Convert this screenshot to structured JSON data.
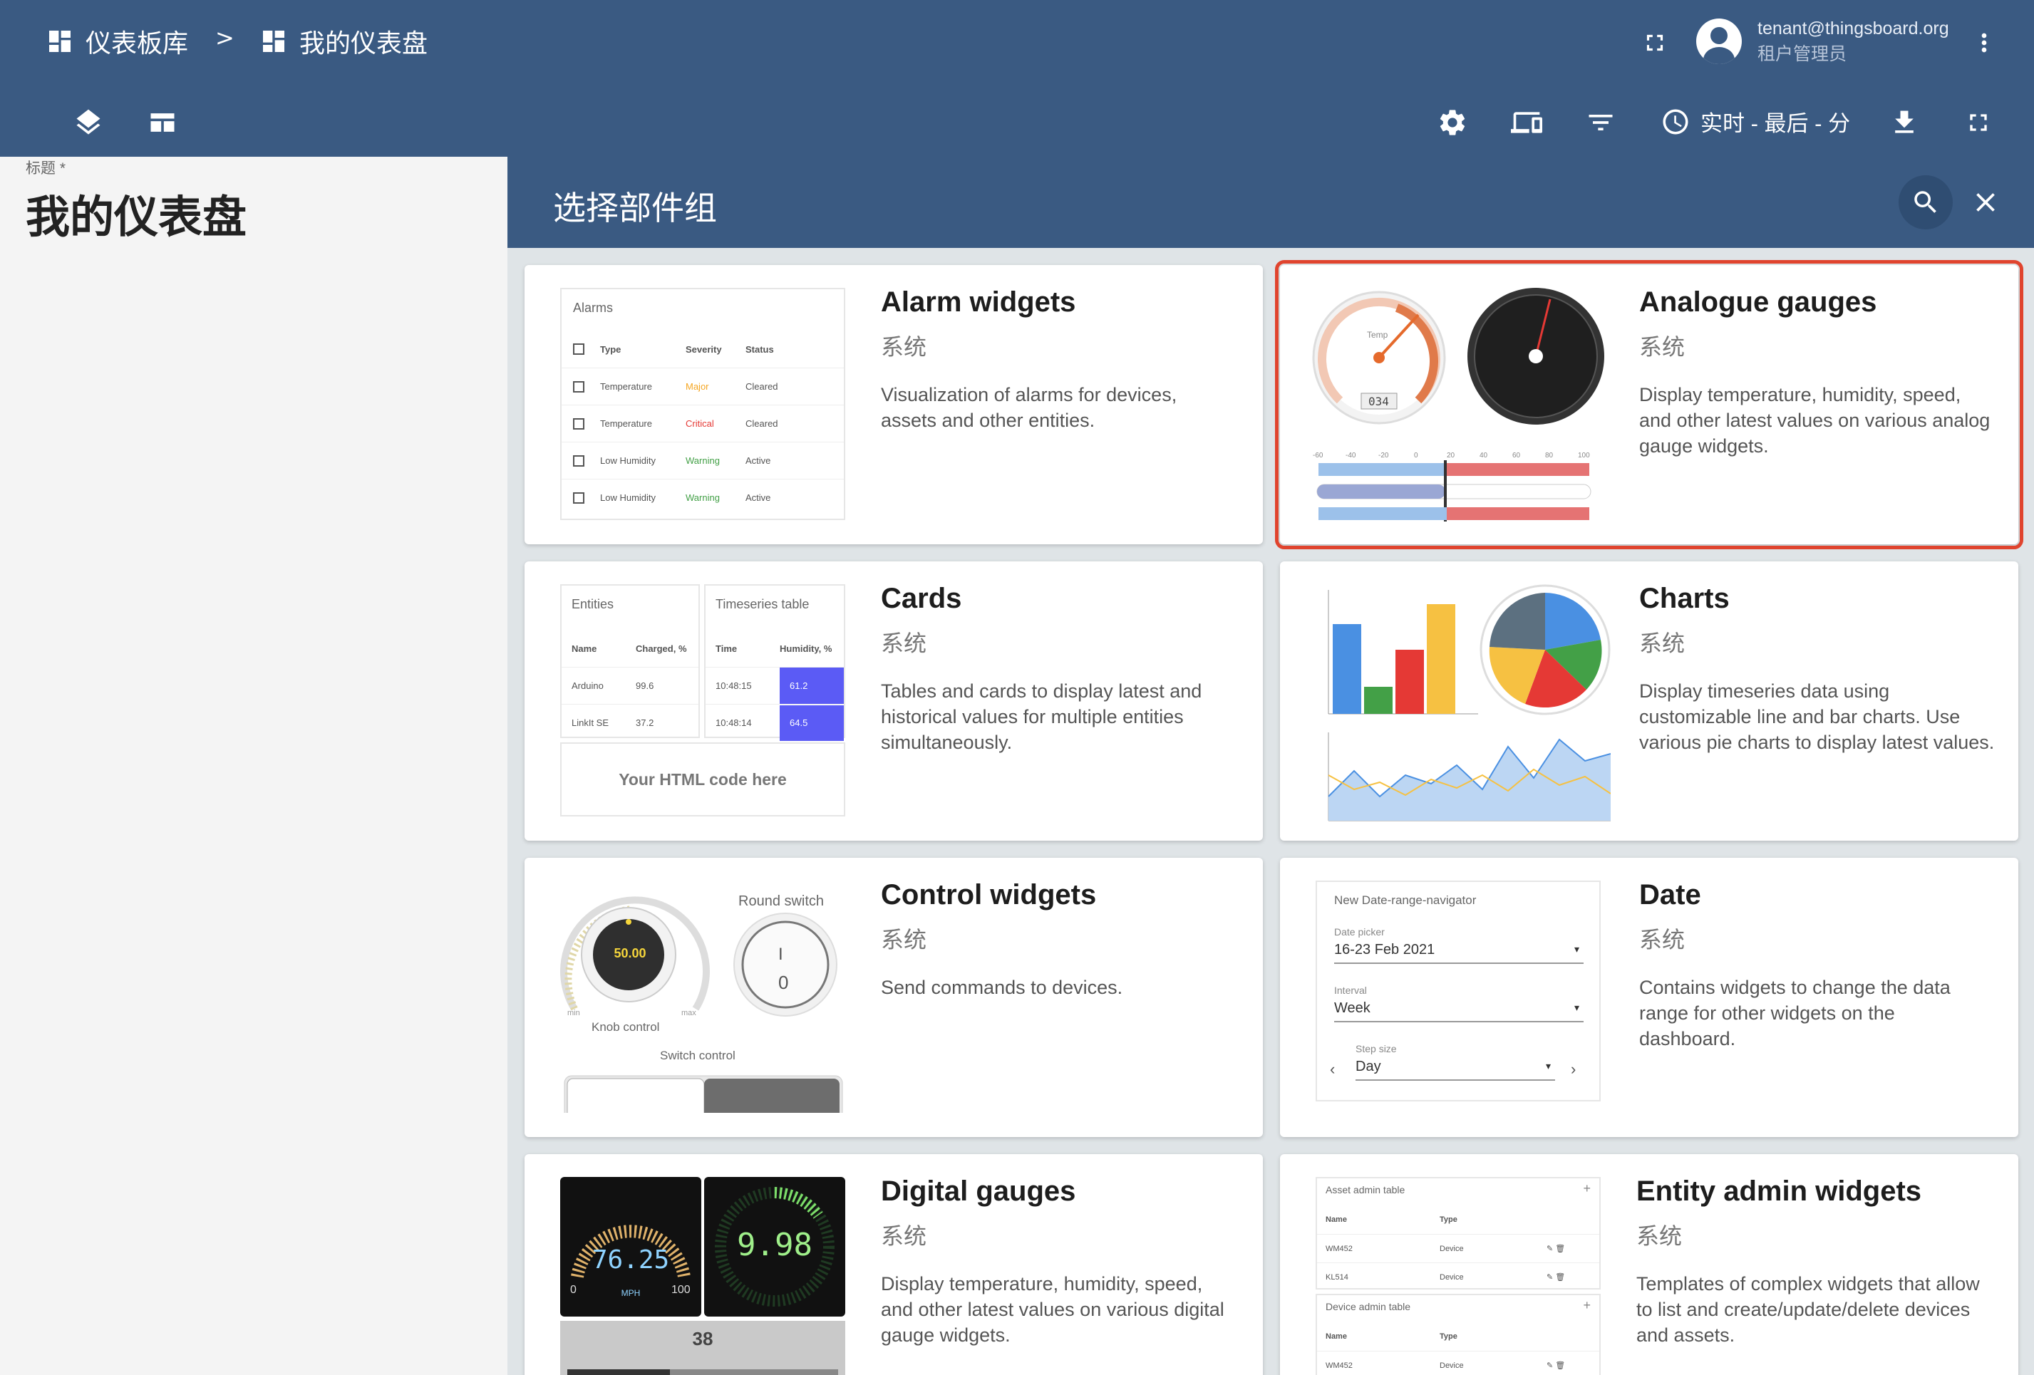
{
  "breadcrumb": {
    "root": "仪表板库",
    "separator": ">",
    "current": "我的仪表盘"
  },
  "user": {
    "email": "tenant@thingsboard.org",
    "role": "租户管理员"
  },
  "toolbar": {
    "timewindow": "实时 - 最后 - 分"
  },
  "left": {
    "title_label": "标题 *",
    "title_value": "我的仪表盘"
  },
  "panel": {
    "title": "选择部件组"
  },
  "cards": [
    {
      "title": "Alarm widgets",
      "source": "系统",
      "description": "Visualization of alarms for devices, assets and other entities."
    },
    {
      "title": "Analogue gauges",
      "source": "系统",
      "description": "Display temperature, humidity, speed, and other latest values on various analog gauge widgets."
    },
    {
      "title": "Cards",
      "source": "系统",
      "description": "Tables and cards to display latest and historical values for multiple entities simultaneously."
    },
    {
      "title": "Charts",
      "source": "系统",
      "description": "Display timeseries data using customizable line and bar charts. Use various pie charts to display latest values."
    },
    {
      "title": "Control widgets",
      "source": "系统",
      "description": "Send commands to devices."
    },
    {
      "title": "Date",
      "source": "系统",
      "description": "Contains widgets to change the data range for other widgets on the dashboard."
    },
    {
      "title": "Digital gauges",
      "source": "系统",
      "description": "Display temperature, humidity, speed, and other latest values on various digital gauge widgets."
    },
    {
      "title": "Entity admin widgets",
      "source": "系统",
      "description": "Templates of complex widgets that allow to list and create/update/delete devices and assets."
    }
  ],
  "previews": {
    "alarms": {
      "title": "Alarms",
      "headers": [
        "Type",
        "Severity",
        "Status"
      ],
      "rows": [
        [
          "Temperature",
          "Major",
          "Cleared"
        ],
        [
          "Temperature",
          "Critical",
          "Cleared"
        ],
        [
          "Low Humidity",
          "Warning",
          "Active"
        ],
        [
          "Low Humidity",
          "Warning",
          "Active"
        ]
      ]
    },
    "cards": {
      "entities_title": "Entities",
      "entities_headers": [
        "Name",
        "Charged, %"
      ],
      "entities_rows": [
        [
          "Arduino",
          "99.6"
        ],
        [
          "LinkIt SE",
          "37.2"
        ]
      ],
      "ts_title": "Timeseries table",
      "ts_headers": [
        "Time",
        "Humidity, %"
      ],
      "ts_rows": [
        [
          "10:48:15",
          "61.2"
        ],
        [
          "10:48:14",
          "64.5"
        ]
      ],
      "html_text": "Your HTML code here"
    },
    "control": {
      "knob_value": "50.00",
      "knob_label": "Knob control",
      "min": "min",
      "max": "max",
      "round_label": "Round switch",
      "round_on": "I",
      "round_off": "0",
      "switch_label": "Switch control"
    },
    "date": {
      "title": "New Date-range-navigator",
      "picker_label": "Date picker",
      "picker_value": "16-23 Feb 2021",
      "interval_label": "Interval",
      "interval_value": "Week",
      "step_label": "Step size",
      "step_value": "Day"
    },
    "digital": {
      "speed": "76.25",
      "unit": "MPH",
      "min": "0",
      "max": "100",
      "value2": "9.98",
      "value3": "38"
    },
    "entity_admin": {
      "asset_title": "Asset admin table",
      "device_title": "Device admin table",
      "headers": [
        "Name",
        "Type"
      ],
      "asset_rows": [
        [
          "WM452",
          "Device"
        ],
        [
          "KL514",
          "Device"
        ]
      ],
      "device_rows": [
        [
          "WM452",
          "Device"
        ]
      ]
    },
    "analog": {
      "temp_label": "Temp",
      "temp_value": "034",
      "scale": [
        "-60",
        "-40",
        "-20",
        "0",
        "20",
        "40",
        "60",
        "80",
        "100"
      ]
    }
  },
  "colors": {
    "header": "#3a5a82",
    "selected_outline": "#e0442e",
    "major": "#f5a623",
    "critical": "#e53935",
    "warning": "#43a047"
  }
}
